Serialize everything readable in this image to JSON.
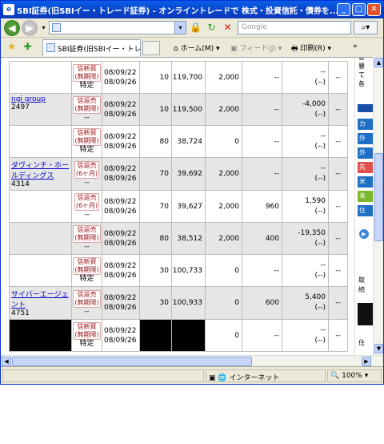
{
  "window": {
    "title": "SBI証券(旧SBIイー・トレード証券) - オンライントレードで 株式・投資信託・債券を... - Wind...",
    "app_icon": "ie-icon"
  },
  "toolbar": {
    "address_value": "",
    "search_placeholder": "Google",
    "tab_title": "SBI証券(旧SBIイー・トレー...",
    "home_label": "ホーム(M)",
    "feed_label": "フィード(J)",
    "print_label": "印刷(R)"
  },
  "status": {
    "zone": "インターネット",
    "zoom": "100%"
  },
  "right_panel": {
    "lines": [
      "各",
      "暴",
      "て",
      "各"
    ],
    "buttons": [
      {
        "label": "カ",
        "color": "#1f6fc4"
      },
      {
        "label": "外",
        "color": "#1f6fc4"
      },
      {
        "label": "外",
        "color": "#1f6fc4"
      },
      {
        "label": "先",
        "color": "#e0504a"
      },
      {
        "label": "米",
        "color": "#1f6fc4"
      },
      {
        "label": "未",
        "color": "#7ab829"
      },
      {
        "label": "住",
        "color": "#1f6fc4"
      }
    ],
    "bottom_texts": [
      "取",
      "続",
      "住"
    ]
  },
  "table": {
    "rows": [
      {
        "name": "",
        "code": "",
        "type": "信新買",
        "period": "(無期限)",
        "tail": "特定",
        "date1": "08/09/22",
        "date2": "08/09/26",
        "qty": "10",
        "price": "119,700",
        "cost": "2,000",
        "fee": "--",
        "pl1": "--",
        "pl2": "(--)",
        "last": "--",
        "shade": "w",
        "show_name": false
      },
      {
        "name": "ngi group",
        "code": "2497",
        "type": "信返売",
        "period": "(無期限)",
        "tail": "--",
        "date1": "08/09/22",
        "date2": "08/09/26",
        "qty": "10",
        "price": "119,500",
        "cost": "2,000",
        "fee": "--",
        "pl1": "-4,000",
        "pl2": "(--)",
        "last": "--",
        "shade": "g",
        "show_name": true
      },
      {
        "name": "",
        "code": "",
        "type": "信新買",
        "period": "(無期限)",
        "tail": "特定",
        "date1": "08/09/22",
        "date2": "08/09/26",
        "qty": "80",
        "price": "38,724",
        "cost": "0",
        "fee": "--",
        "pl1": "--",
        "pl2": "(--)",
        "last": "--",
        "shade": "w",
        "show_name": false
      },
      {
        "name": "ダヴィンチ・ホールディングス",
        "code": "4314",
        "type": "信返売",
        "period": "(6ヶ月)",
        "tail": "--",
        "date1": "08/09/22",
        "date2": "08/09/26",
        "qty": "70",
        "price": "39,692",
        "cost": "2,000",
        "fee": "--",
        "pl1": "--",
        "pl2": "(--)",
        "last": "--",
        "shade": "g",
        "show_name": true
      },
      {
        "name": "",
        "code": "",
        "type": "信返売",
        "period": "(6ヶ月)",
        "tail": "--",
        "date1": "08/09/22",
        "date2": "08/09/26",
        "qty": "70",
        "price": "39,627",
        "cost": "2,000",
        "fee": "960",
        "pl1": "1,590",
        "pl2": "(--)",
        "last": "--",
        "shade": "w",
        "show_name": false
      },
      {
        "name": "",
        "code": "",
        "type": "信返売",
        "period": "(無期限)",
        "tail": "--",
        "date1": "08/09/22",
        "date2": "08/09/26",
        "qty": "80",
        "price": "38,512",
        "cost": "2,000",
        "fee": "400",
        "pl1": "-19,350",
        "pl2": "(--)",
        "last": "--",
        "shade": "g",
        "show_name": false
      },
      {
        "name": "",
        "code": "",
        "type": "信新買",
        "period": "(無期限)",
        "tail": "特定",
        "date1": "08/09/22",
        "date2": "08/09/26",
        "qty": "30",
        "price": "100,733",
        "cost": "0",
        "fee": "--",
        "pl1": "--",
        "pl2": "(--)",
        "last": "--",
        "shade": "w",
        "show_name": false
      },
      {
        "name": "サイバーエージェント",
        "code": "4751",
        "type": "信返売",
        "period": "(無期限)",
        "tail": "--",
        "date1": "08/09/22",
        "date2": "08/09/26",
        "qty": "30",
        "price": "100,933",
        "cost": "0",
        "fee": "600",
        "pl1": "5,400",
        "pl2": "(--)",
        "last": "--",
        "shade": "g",
        "show_name": true
      },
      {
        "name": "",
        "code": "",
        "type": "信新買",
        "period": "(無期限)",
        "tail": "特定",
        "date1": "08/09/22",
        "date2": "08/09/26",
        "qty": "",
        "price": "",
        "cost": "0",
        "fee": "--",
        "pl1": "--",
        "pl2": "(--)",
        "last": "--",
        "shade": "w",
        "show_name": false,
        "redacted": true
      }
    ]
  }
}
